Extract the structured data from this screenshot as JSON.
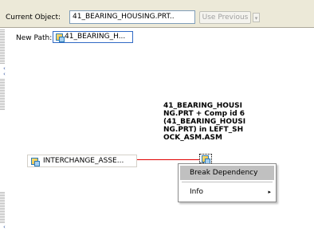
{
  "toolbar": {
    "current_object_label": "Current Object:",
    "current_object_value": "41_BEARING_HOUSING.PRT..",
    "use_previous_label": "Use Previous",
    "use_previous_arrow": "▾"
  },
  "path_bar": {
    "new_path_label": "New Path:",
    "path_item": "41_BEARING_H..."
  },
  "canvas": {
    "target_description": "41_BEARING_HOUSING.PRT + Comp id 6 (41_BEARING_HOUSING.PRT) in LEFT_SHOCK_ASM.ASM",
    "source_node_label": "INTERCHANGE_ASSE...",
    "dependency_color": "#e00000"
  },
  "context_menu": {
    "items": [
      {
        "label": "Break Dependency",
        "selected": true
      },
      {
        "label": "Info",
        "has_submenu": true,
        "submenu_arrow": "▸"
      }
    ]
  },
  "side_controls": {
    "collapse_arrows": [
      "‹",
      "‹"
    ],
    "expand_arrow": "‹"
  }
}
